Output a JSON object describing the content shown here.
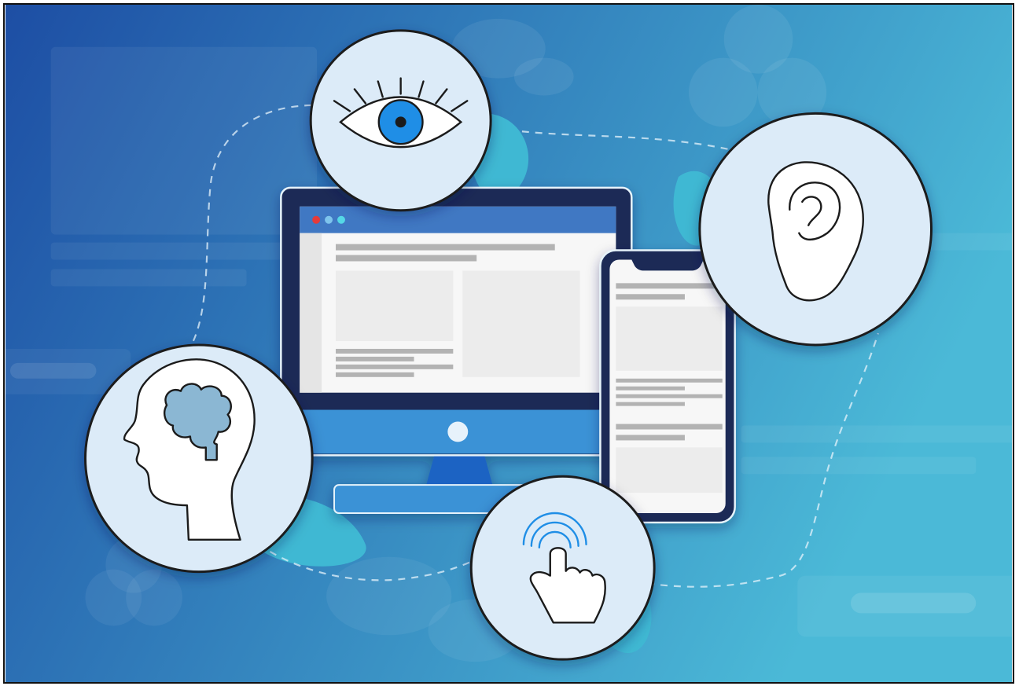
{
  "illustration": {
    "theme": "digital-accessibility",
    "colors": {
      "background_left": "#1d4ea4",
      "background_right": "#4bb9d7",
      "blob": "#3fb8d3",
      "circle_fill": "#dcebf8",
      "outline": "#1b1b1b",
      "monitor_frame": "#1a2a57",
      "monitor_chin": "#3a92d6",
      "titlebar": "#3f78c3",
      "iris": "#1f8ee6",
      "brain": "#8bb7d3",
      "screen_placeholder": "#efefef",
      "text_line": "#b3b3b3",
      "window_dot_red": "#e53a3a",
      "window_dot_blue": "#7ec4ec",
      "window_dot_cyan": "#54d8e6"
    },
    "icons": [
      "eye-icon",
      "ear-icon",
      "brain-head-icon",
      "touch-hand-icon"
    ],
    "devices": [
      "desktop-monitor",
      "smartphone"
    ]
  }
}
